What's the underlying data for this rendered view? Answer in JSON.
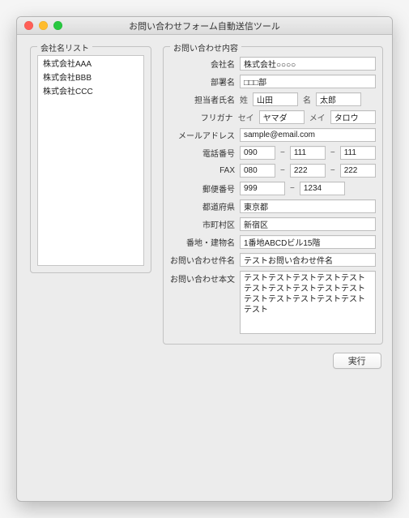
{
  "window": {
    "title": "お問い合わせフォーム自動送信ツール"
  },
  "list": {
    "title": "会社名リスト",
    "items": [
      {
        "label": "株式会社AAA"
      },
      {
        "label": "株式会社BBB"
      },
      {
        "label": "株式会社CCC"
      }
    ]
  },
  "form": {
    "title": "お問い合わせ内容",
    "labels": {
      "company": "会社名",
      "department": "部署名",
      "contact_name": "担当者氏名",
      "last_name": "姓",
      "first_name": "名",
      "furigana": "フリガナ",
      "last_kana": "セイ",
      "first_kana": "メイ",
      "email": "メールアドレス",
      "phone": "電話番号",
      "fax": "FAX",
      "postal": "郵便番号",
      "prefecture": "都道府県",
      "city": "市町村区",
      "address": "番地・建物名",
      "subject": "お問い合わせ件名",
      "body": "お問い合わせ本文"
    },
    "values": {
      "company": "株式会社○○○○",
      "department": "□□□部",
      "last_name": "山田",
      "first_name": "太郎",
      "last_kana": "ヤマダ",
      "first_kana": "タロウ",
      "email": "sample@email.com",
      "phone": {
        "a": "090",
        "b": "111",
        "c": "111"
      },
      "fax": {
        "a": "080",
        "b": "222",
        "c": "222"
      },
      "postal": {
        "a": "999",
        "b": "1234"
      },
      "prefecture": "東京都",
      "city": "新宿区",
      "address": "1番地ABCDビル15階",
      "subject": "テストお問い合わせ件名",
      "body": "テストテストテストテストテストテストテストテストテストテストテストテストテストテストテストテスト"
    }
  },
  "buttons": {
    "execute": "実行"
  },
  "glyphs": {
    "dash": "−"
  }
}
